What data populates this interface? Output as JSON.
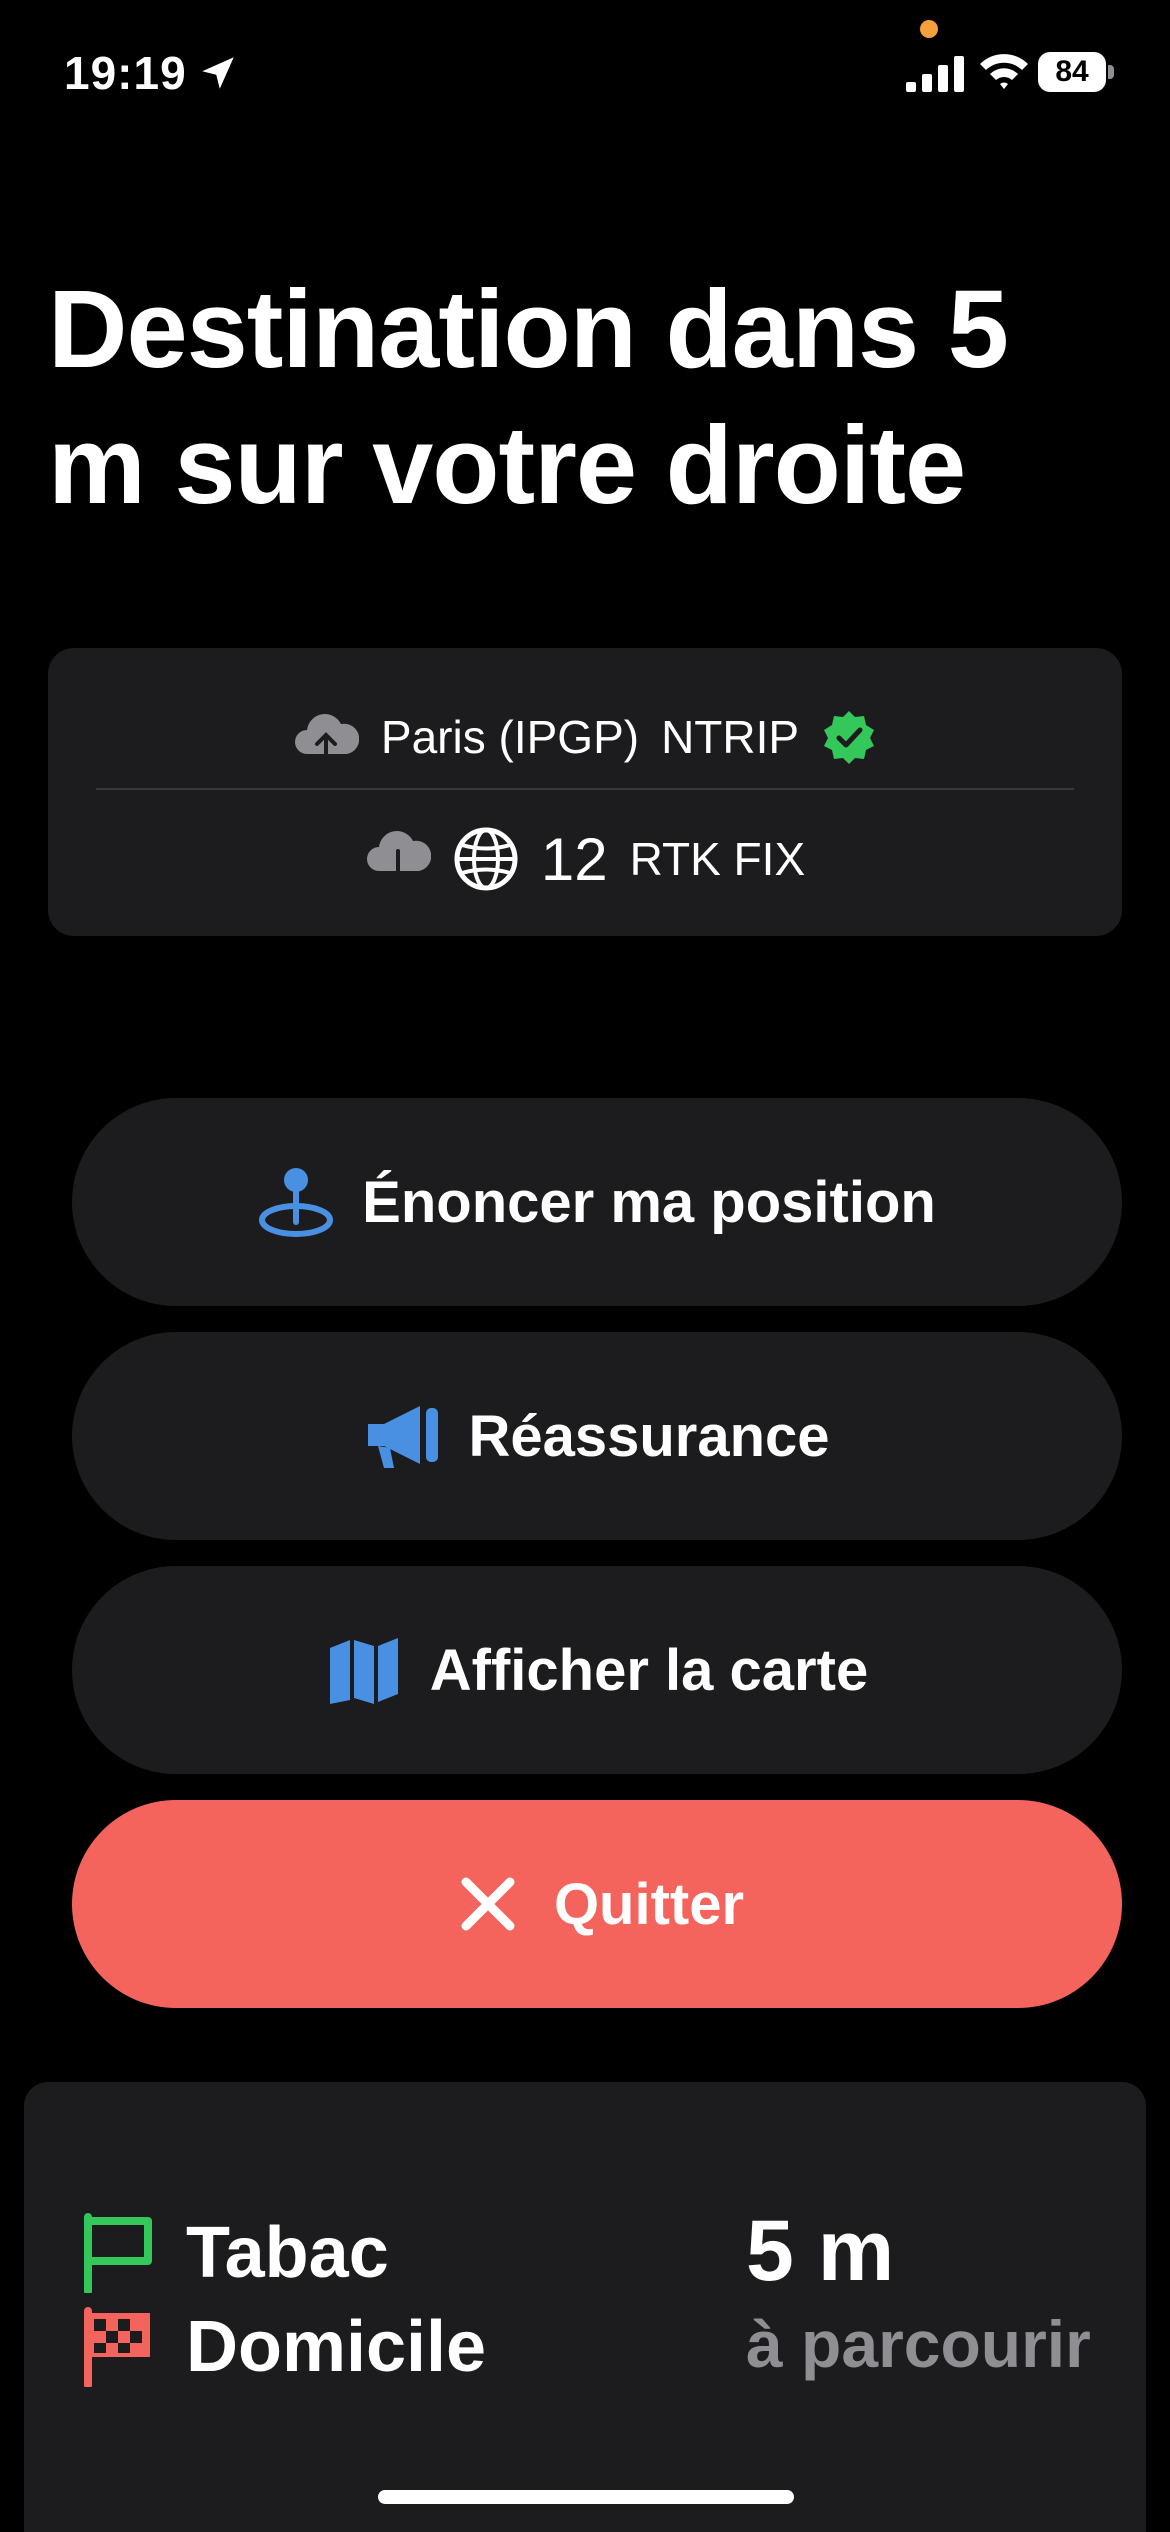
{
  "status_bar": {
    "time": "19:19",
    "battery": "84",
    "icons": [
      "location-arrow-icon",
      "signal-icon",
      "wifi-icon",
      "battery-icon"
    ]
  },
  "instruction": {
    "text": "Destination dans 5 m sur votre droite"
  },
  "gps_card": {
    "source": "Paris (IPGP)",
    "protocol": "NTRIP",
    "satellites": "12",
    "fix_status": "RTK FIX",
    "colors": {
      "verified": "#34c759",
      "background": "#1c1c1e"
    }
  },
  "actions": {
    "announce_position": "Énoncer ma position",
    "reassurance": "Réassurance",
    "show_map": "Afficher la carte",
    "quit": "Quitter",
    "colors": {
      "icon_accent": "#4a90e2",
      "quit_background": "#f4645d"
    }
  },
  "trip": {
    "origin": "Tabac",
    "destination": "Domicile",
    "distance": "5 m",
    "distance_label": "à parcourir",
    "colors": {
      "origin_flag": "#34c759",
      "destination_flag": "#f4645d"
    }
  }
}
